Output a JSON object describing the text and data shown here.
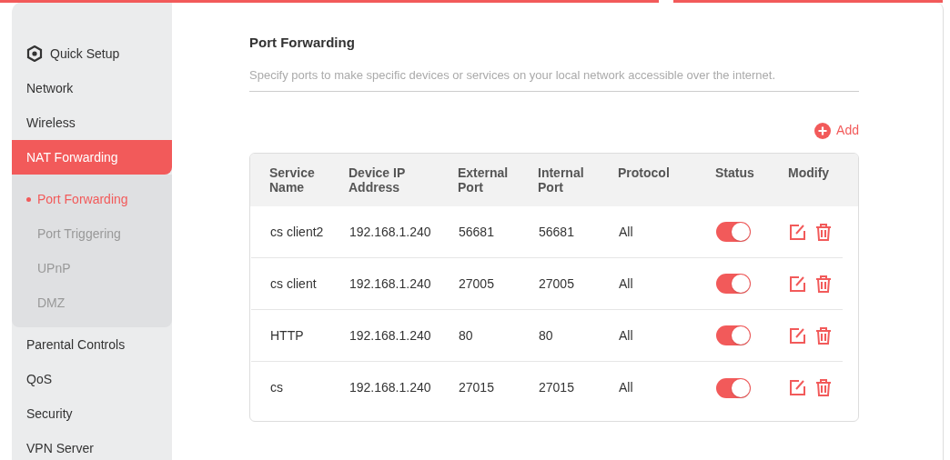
{
  "sidebar": {
    "items": [
      {
        "label": "Quick Setup",
        "kind": "setup",
        "selected": false
      },
      {
        "label": "Network",
        "kind": "plain",
        "selected": false
      },
      {
        "label": "Wireless",
        "kind": "plain",
        "selected": false
      },
      {
        "label": "NAT Forwarding",
        "kind": "plain",
        "selected": true,
        "expanded": true,
        "children": [
          {
            "label": "Port Forwarding",
            "selected": true
          },
          {
            "label": "Port Triggering",
            "selected": false
          },
          {
            "label": "UPnP",
            "selected": false
          },
          {
            "label": "DMZ",
            "selected": false
          }
        ]
      },
      {
        "label": "Parental Controls",
        "kind": "plain",
        "selected": false
      },
      {
        "label": "QoS",
        "kind": "plain",
        "selected": false
      },
      {
        "label": "Security",
        "kind": "plain",
        "selected": false
      },
      {
        "label": "VPN Server",
        "kind": "plain",
        "selected": false
      }
    ]
  },
  "page": {
    "title": "Port Forwarding",
    "description": "Specify ports to make specific devices or services on your local network accessible over the internet.",
    "add": "Add"
  },
  "table": {
    "columns": [
      "Service Name",
      "Device IP Address",
      "External Port",
      "Internal Port",
      "Protocol",
      "Status",
      "Modify"
    ],
    "rows": [
      {
        "cells": [
          "cs client2",
          "192.168.1.240",
          "56681",
          "56681",
          "All"
        ],
        "on": true
      },
      {
        "cells": [
          "cs client",
          "192.168.1.240",
          "27005",
          "27005",
          "All"
        ],
        "on": true
      },
      {
        "cells": [
          "HTTP",
          "192.168.1.240",
          "80",
          "80",
          "All"
        ],
        "on": true
      },
      {
        "cells": [
          "cs",
          "192.168.1.240",
          "27015",
          "27015",
          "All"
        ],
        "on": true
      }
    ]
  }
}
